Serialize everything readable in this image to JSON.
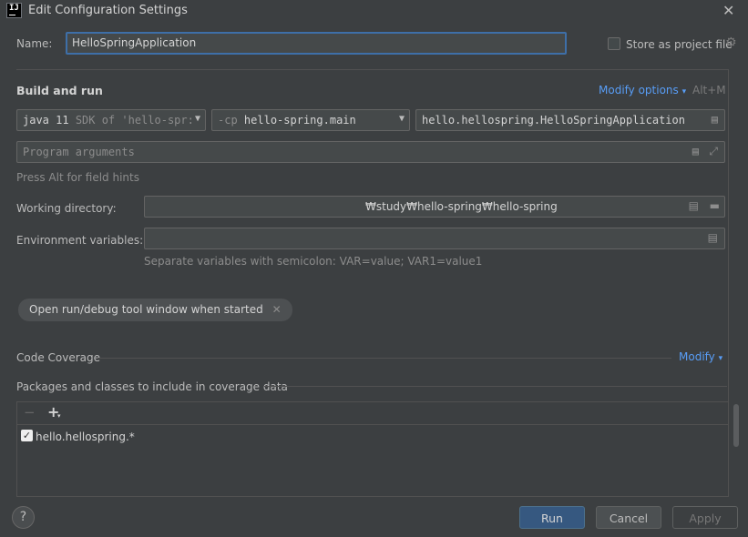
{
  "window": {
    "logo_text": "IJ",
    "title": "Edit Configuration Settings"
  },
  "name_row": {
    "label": "Name:",
    "value": "HelloSpringApplication",
    "store_label": "Store as project file"
  },
  "build_run": {
    "title": "Build and run",
    "modify_options": "Modify options",
    "modify_shortcut": "Alt+M",
    "jdk_combo": {
      "main": "java 11",
      "detail": "SDK of 'hello-spr:"
    },
    "module_combo": {
      "prefix": "-cp",
      "value": "hello-spring.main"
    },
    "main_class": "hello.hellospring.HelloSpringApplication",
    "program_args_placeholder": "Program arguments",
    "field_hint": "Press Alt for field hints",
    "working_dir_label": "Working directory:",
    "working_dir_value": "₩study₩hello-spring₩hello-spring",
    "env_label": "Environment variables:",
    "env_hint": "Separate variables with semicolon: VAR=value; VAR1=value1"
  },
  "tag": {
    "label": "Open run/debug tool window when started"
  },
  "coverage": {
    "title": "Code Coverage",
    "modify": "Modify",
    "packages_title": "Packages and classes to include in coverage data",
    "items": [
      "hello.hellospring.*"
    ]
  },
  "footer": {
    "help": "?",
    "run": "Run",
    "cancel": "Cancel",
    "apply": "Apply"
  },
  "colors": {
    "background": "#3c3f41",
    "accent": "#589df6",
    "primary_button": "#365880"
  }
}
